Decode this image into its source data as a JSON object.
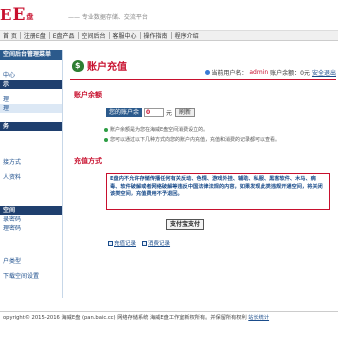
{
  "header": {
    "logo_prefix": "E",
    "logo_big": "E",
    "logo_suffix": "盘",
    "slogan": "—— 专业数据存储、交流平台"
  },
  "nav": {
    "items": [
      "首 页",
      "注册E盘",
      "E盘产品",
      "空间后台",
      "客服中心",
      "操作指南",
      "程序介绍"
    ]
  },
  "sidebar": {
    "title": "空间后台管理菜单",
    "items": [
      {
        "label": "",
        "style": "plain"
      },
      {
        "label": "中心",
        "style": "plain"
      },
      {
        "label": "示",
        "style": "dark"
      },
      {
        "label": "",
        "style": "gap"
      },
      {
        "label": "理",
        "style": "plain"
      },
      {
        "label": "理",
        "style": "sub"
      },
      {
        "label": "",
        "style": "plain"
      },
      {
        "label": "务",
        "style": "dark"
      },
      {
        "label": "",
        "style": "plain"
      },
      {
        "label": "",
        "style": "plain"
      },
      {
        "label": "",
        "style": "plain"
      },
      {
        "label": "接方式",
        "style": "plain"
      },
      {
        "label": "",
        "style": "gap"
      },
      {
        "label": "人资料",
        "style": "plain"
      },
      {
        "label": "",
        "style": "plain"
      },
      {
        "label": "",
        "style": "gap"
      },
      {
        "label": "",
        "style": "plain"
      },
      {
        "label": "空间",
        "style": "dark"
      },
      {
        "label": "录密码",
        "style": "plain"
      },
      {
        "label": "理密码",
        "style": "plain"
      },
      {
        "label": "",
        "style": "plain"
      },
      {
        "label": "",
        "style": "gap"
      },
      {
        "label": "",
        "style": "plain"
      },
      {
        "label": "户类型",
        "style": "plain"
      },
      {
        "label": "",
        "style": "gap"
      },
      {
        "label": "下载空间设置",
        "style": "plain"
      },
      {
        "label": "",
        "style": "plain"
      }
    ]
  },
  "main": {
    "page_title": "账户充值",
    "user_label": "当前用户名：",
    "username": "admin",
    "balance_summary": "账户余额：0元",
    "logout": "安全退出",
    "balance_section": "账户余额",
    "balance_label": "您的账户余额",
    "balance_value": "0",
    "balance_unit": "元",
    "refresh_button": "刷新",
    "notes": [
      "账户余额是为您在海威E盘空间消费设立的。",
      "您可以通过以下几种方式向您的账户内充值，充值和消费的记录都可以查看。"
    ],
    "recharge_section": "充值方式",
    "warning_text": "E盘内不允许存储传播任何有关反动、色情、游戏外挂、辅助、私服、黑客软件、木马、病毒、软件破解或者网络破解等违反中国法律法规的内容，如果发现此类违规开通空间，将关闭该类空间，充值费用不予退回。",
    "alipay_button": "支付宝支付",
    "records": [
      "充值记录",
      "消费记录"
    ]
  },
  "footer": {
    "text": "opyright© 2015-2016 海威E盘 (pan.baic.cc) 网络存储系统 海威E盘工作室新权所有。并保留所有权利",
    "link": "站长统计"
  },
  "colors": {
    "brand_red": "#c8102e",
    "sidebar_blue": "#2b5a8c",
    "link_blue": "#1a4c8b"
  }
}
